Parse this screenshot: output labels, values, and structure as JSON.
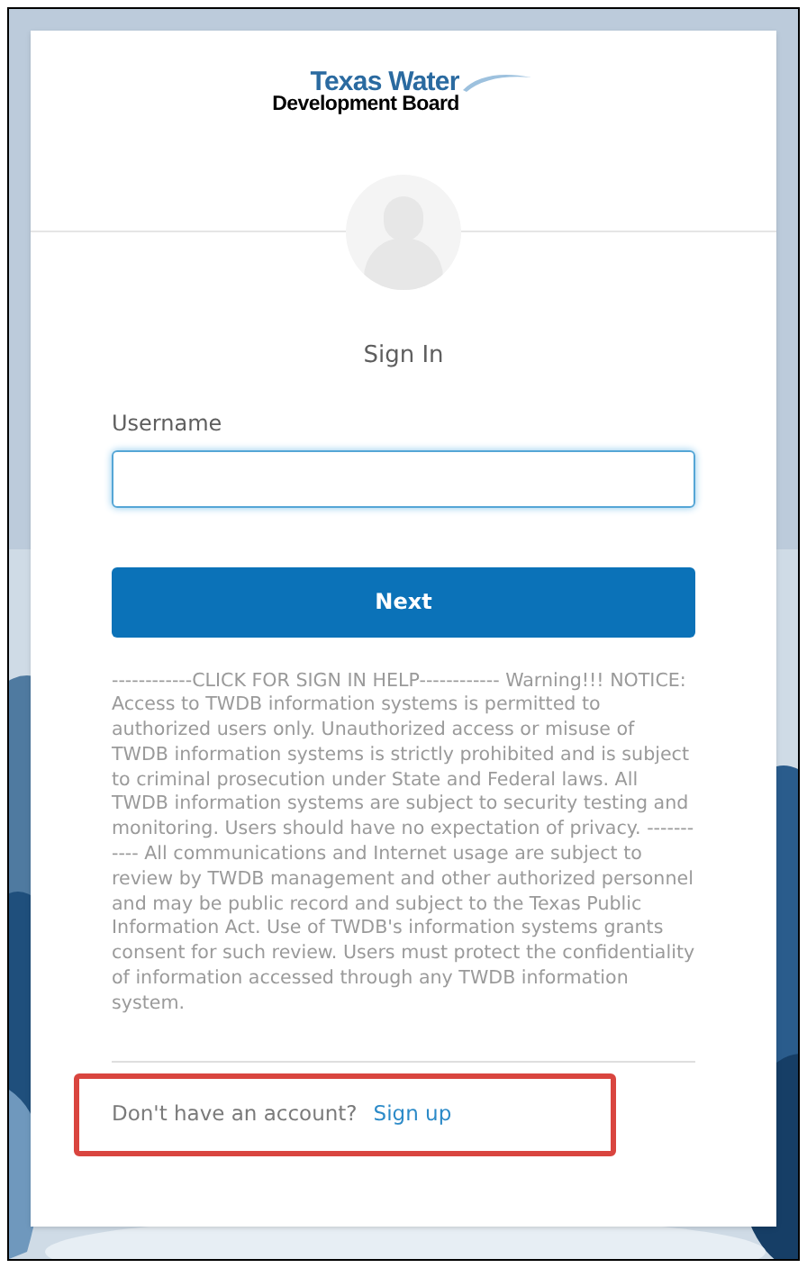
{
  "logo": {
    "line_1": "Texas Water",
    "line_2": "Development Board"
  },
  "title": "Sign In",
  "username": {
    "label": "Username"
  },
  "next_button": "Next",
  "notice": "------------CLICK FOR SIGN IN HELP------------ Warning!!! NOTICE: Access to TWDB information systems is permitted to authorized users only. Unauthorized access or misuse of TWDB information systems is strictly prohibited and is subject to criminal prosecution under State and Federal laws. All TWDB information systems are subject to security testing and monitoring. Users should have no expectation of privacy. ----------- All communications and Internet usage are subject to review by TWDB management and other authorized personnel and may be public record and subject to the Texas Public Information Act. Use of TWDB's information systems grants consent for such review. Users must protect the confidentiality of information accessed through any TWDB information system.",
  "signup": {
    "prompt": "Don't have an account?",
    "link": "Sign up",
    "highlighted": true
  }
}
